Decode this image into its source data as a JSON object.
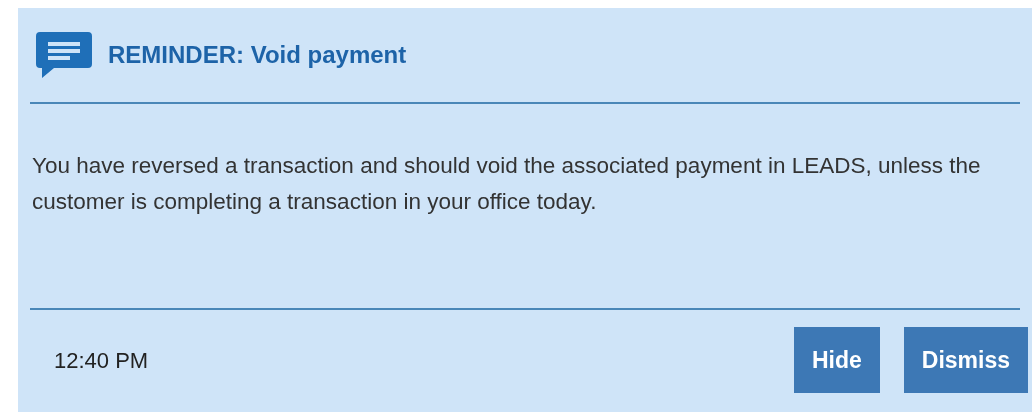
{
  "notification": {
    "title": "REMINDER: Void payment",
    "message": "You have reversed a transaction and should void the associated payment in LEADS, unless the customer is completing a transaction in your office today.",
    "time": "12:40 PM",
    "buttons": [
      "Hide",
      "Dismiss"
    ]
  }
}
